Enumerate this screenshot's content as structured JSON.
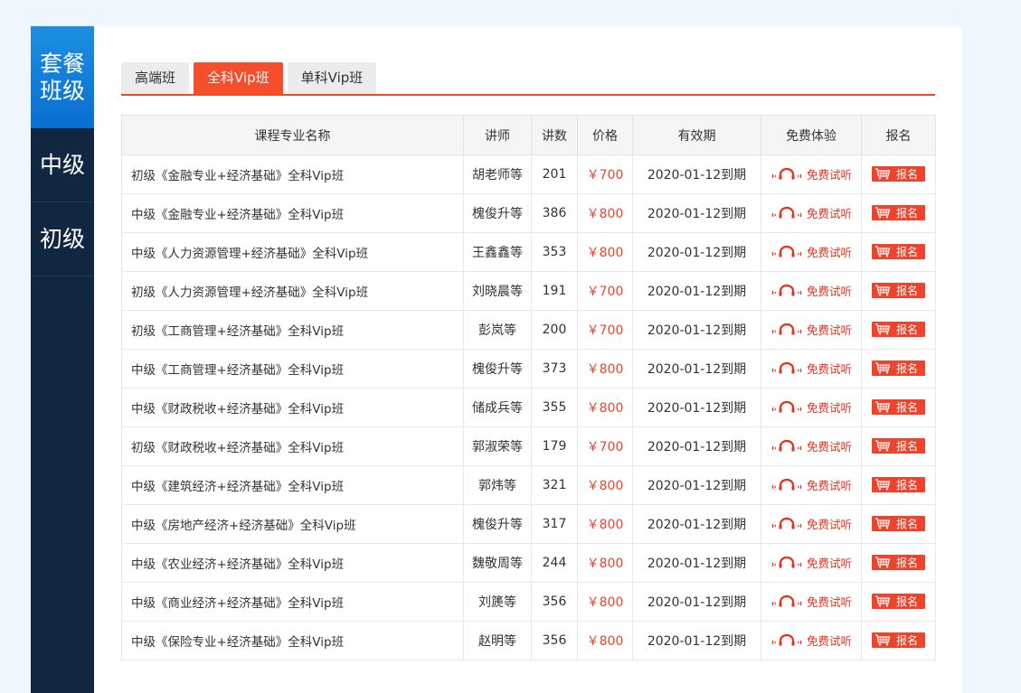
{
  "sidebar": {
    "items": [
      {
        "label": "套餐\n班级"
      },
      {
        "label": "中级"
      },
      {
        "label": "初级"
      }
    ]
  },
  "tabs": [
    {
      "label": "高端班"
    },
    {
      "label": "全科Vip班"
    },
    {
      "label": "单科Vip班"
    }
  ],
  "table": {
    "headers": [
      "课程专业名称",
      "讲师",
      "讲数",
      "价格",
      "有效期",
      "免费体验",
      "报名"
    ],
    "rows": [
      {
        "name": "初级《金融专业+经济基础》全科Vip班",
        "teacher": "胡老师等",
        "lectures": "201",
        "price": "￥700",
        "validity": "2020-01-12到期",
        "trial": "免费试听",
        "enroll": "报名"
      },
      {
        "name": "中级《金融专业+经济基础》全科Vip班",
        "teacher": "槐俊升等",
        "lectures": "386",
        "price": "￥800",
        "validity": "2020-01-12到期",
        "trial": "免费试听",
        "enroll": "报名"
      },
      {
        "name": "中级《人力资源管理+经济基础》全科Vip班",
        "teacher": "王鑫鑫等",
        "lectures": "353",
        "price": "￥800",
        "validity": "2020-01-12到期",
        "trial": "免费试听",
        "enroll": "报名"
      },
      {
        "name": "初级《人力资源管理+经济基础》全科Vip班",
        "teacher": "刘晓晨等",
        "lectures": "191",
        "price": "￥700",
        "validity": "2020-01-12到期",
        "trial": "免费试听",
        "enroll": "报名"
      },
      {
        "name": "初级《工商管理+经济基础》全科Vip班",
        "teacher": "彭岚等",
        "lectures": "200",
        "price": "￥700",
        "validity": "2020-01-12到期",
        "trial": "免费试听",
        "enroll": "报名"
      },
      {
        "name": "中级《工商管理+经济基础》全科Vip班",
        "teacher": "槐俊升等",
        "lectures": "373",
        "price": "￥800",
        "validity": "2020-01-12到期",
        "trial": "免费试听",
        "enroll": "报名"
      },
      {
        "name": "中级《财政税收+经济基础》全科Vip班",
        "teacher": "储成兵等",
        "lectures": "355",
        "price": "￥800",
        "validity": "2020-01-12到期",
        "trial": "免费试听",
        "enroll": "报名"
      },
      {
        "name": "初级《财政税收+经济基础》全科Vip班",
        "teacher": "郭淑荣等",
        "lectures": "179",
        "price": "￥700",
        "validity": "2020-01-12到期",
        "trial": "免费试听",
        "enroll": "报名"
      },
      {
        "name": "中级《建筑经济+经济基础》全科Vip班",
        "teacher": "郭炜等",
        "lectures": "321",
        "price": "￥800",
        "validity": "2020-01-12到期",
        "trial": "免费试听",
        "enroll": "报名"
      },
      {
        "name": "中级《房地产经济+经济基础》全科Vip班",
        "teacher": "槐俊升等",
        "lectures": "317",
        "price": "￥800",
        "validity": "2020-01-12到期",
        "trial": "免费试听",
        "enroll": "报名"
      },
      {
        "name": "中级《农业经济+经济基础》全科Vip班",
        "teacher": "魏敬周等",
        "lectures": "244",
        "price": "￥800",
        "validity": "2020-01-12到期",
        "trial": "免费试听",
        "enroll": "报名"
      },
      {
        "name": "中级《商业经济+经济基础》全科Vip班",
        "teacher": "刘篪等",
        "lectures": "356",
        "price": "￥800",
        "validity": "2020-01-12到期",
        "trial": "免费试听",
        "enroll": "报名"
      },
      {
        "name": "中级《保险专业+经济基础》全科Vip班",
        "teacher": "赵明等",
        "lectures": "356",
        "price": "￥800",
        "validity": "2020-01-12到期",
        "trial": "免费试听",
        "enroll": "报名"
      }
    ]
  },
  "icons": {
    "trial": "headphones-icon",
    "enroll": "cart-icon"
  },
  "colors": {
    "accent": "#f44e2c",
    "sidebar_bg": "#112641",
    "sidebar_active": "#0a6fd0",
    "price": "#f0432c"
  }
}
